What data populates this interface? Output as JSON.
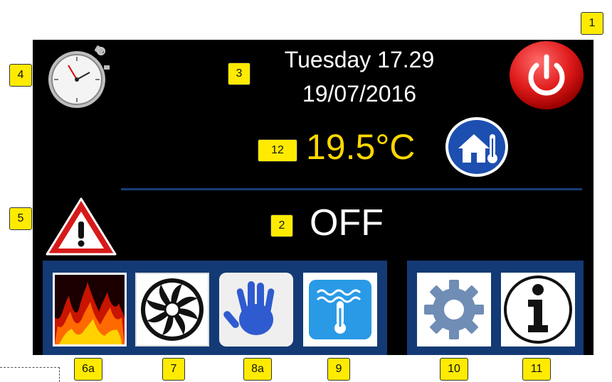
{
  "header": {
    "day_time": "Tuesday 17.29",
    "date": "19/07/2016"
  },
  "temperature": {
    "value": "19.5°C"
  },
  "mode": {
    "status": "OFF"
  },
  "callouts": {
    "power": "1",
    "status": "2",
    "datetime": "3",
    "timer": "4",
    "alarm": "5",
    "fire": "6a",
    "fan": "7",
    "manual": "8a",
    "water": "9",
    "settings": "10",
    "info": "11",
    "temperature": "12"
  },
  "colors": {
    "screen_bg": "#000000",
    "panel": "#133a75",
    "temperature_text": "#ffd800",
    "power_button": "#e01b1b",
    "callout": "#ffeb00"
  },
  "icons": {
    "timer": "stopwatch-icon",
    "power": "power-icon",
    "room_temp": "house-thermometer-icon",
    "alarm": "warning-icon",
    "fire": "fire-icon",
    "fan": "fan-icon",
    "manual": "hand-icon",
    "water": "water-thermometer-icon",
    "settings": "gear-icon",
    "info": "info-icon"
  }
}
